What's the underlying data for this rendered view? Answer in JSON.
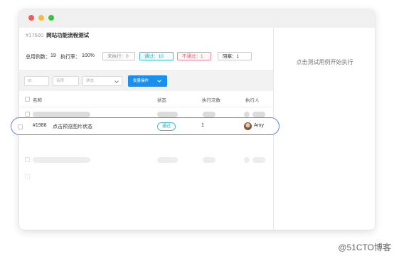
{
  "task": {
    "id": "#17500",
    "name": "网站功能流程测试"
  },
  "stats": {
    "total_label": "总用例数：",
    "total_value": "19",
    "rate_label": "执行率：",
    "rate_value": "100%",
    "not_run": "未执行：0",
    "passed": "通过：10",
    "failed": "不通过：1",
    "blocked": "阻塞：1"
  },
  "filters": {
    "id_placeholder": "ID",
    "name_placeholder": "名称",
    "status_placeholder": "状态",
    "bulk_label": "批量操作"
  },
  "table": {
    "headers": [
      "名称",
      "状态",
      "执行次数",
      "执行人"
    ]
  },
  "focus_row": {
    "id": "#1988",
    "name": "点击预览图片状态",
    "status": "通过",
    "count": "1",
    "executor": "Amy"
  },
  "right_panel": {
    "hint": "点击测试用例开始执行"
  },
  "watermark": "@51CTO博客",
  "colors": {
    "accent": "#1790f0",
    "pass": "#40c1c6",
    "fail": "#f08a9c",
    "focus_outline": "#5d86d8"
  }
}
